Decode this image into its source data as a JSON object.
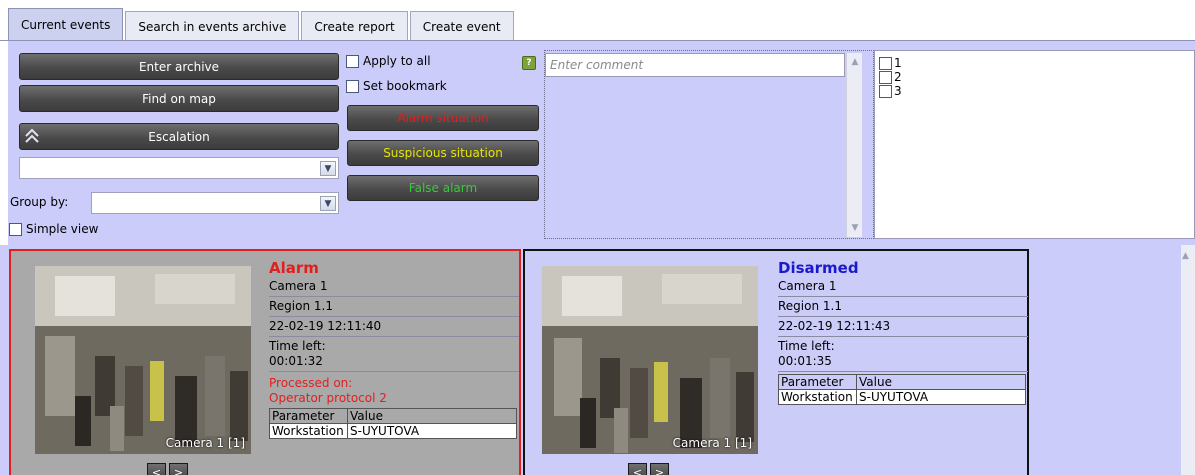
{
  "tabs": [
    {
      "label": "Current events",
      "active": true
    },
    {
      "label": "Search in events archive",
      "active": false
    },
    {
      "label": "Create report",
      "active": false
    },
    {
      "label": "Create event",
      "active": false
    }
  ],
  "panel": {
    "enter_archive": "Enter archive",
    "find_on_map": "Find on map",
    "escalation": "Escalation",
    "group_by_label": "Group by:",
    "simple_view": "Simple view",
    "apply_to_all": "Apply to all",
    "set_bookmark": "Set bookmark",
    "alarm_situation": "Alarm situation",
    "suspicious_situation": "Suspicious situation",
    "false_alarm": "False alarm",
    "help_glyph": "?",
    "comment_placeholder": "Enter comment",
    "list_items": [
      "1",
      "2",
      "3"
    ]
  },
  "events": [
    {
      "status": "Alarm",
      "camera": "Camera 1",
      "region": "Region 1.1",
      "datetime": "22-02-19 12:11:40",
      "time_left_label": "Time left:",
      "time_left": "00:01:32",
      "processed_on": "Processed on:",
      "operator_protocol": "Operator protocol 2",
      "param_header": "Parameter",
      "value_header": "Value",
      "param_name": "Workstation",
      "param_value": "S-UYUTOVA",
      "thumb_label": "Camera 1 [1]",
      "prev": "<",
      "next": ">"
    },
    {
      "status": "Disarmed",
      "camera": "Camera 1",
      "region": "Region 1.1",
      "datetime": "22-02-19 12:11:43",
      "time_left_label": "Time left:",
      "time_left": "00:01:35",
      "param_header": "Parameter",
      "value_header": "Value",
      "param_name": "Workstation",
      "param_value": "S-UYUTOVA",
      "thumb_label": "Camera 1 [1]",
      "prev": "<",
      "next": ">"
    }
  ],
  "colors": {
    "panel_bg": "#ccccfb",
    "alarm_red": "#e02020",
    "suspicious_yellow": "#e6e600",
    "false_alarm_green": "#3cc83c",
    "disarmed_blue": "#1a1acc",
    "processed_red": "#e02020"
  },
  "icons": {
    "escalation": "double-chevron-up-icon",
    "combo_arrow": "chevron-down-icon",
    "help": "help-icon"
  }
}
